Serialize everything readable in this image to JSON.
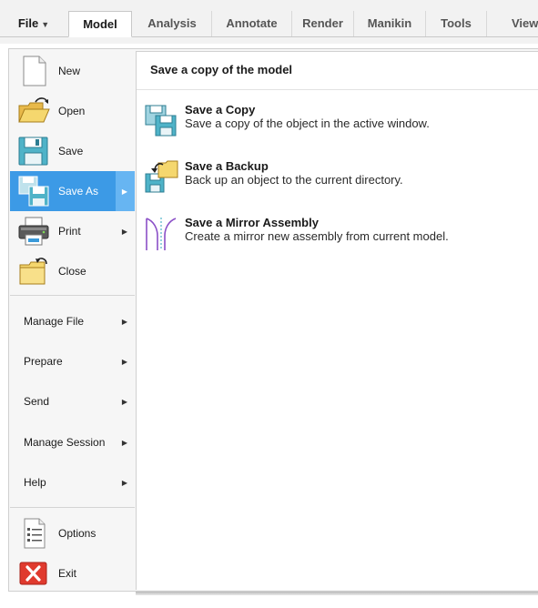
{
  "ribbon": {
    "file_tab": "File",
    "tabs": [
      "Model",
      "Analysis",
      "Annotate",
      "Render",
      "Manikin",
      "Tools",
      "View"
    ],
    "active_tab": "Model"
  },
  "file_menu": {
    "primary_items": [
      {
        "label": "New",
        "icon": "new-document-icon"
      },
      {
        "label": "Open",
        "icon": "open-folder-icon"
      },
      {
        "label": "Save",
        "icon": "save-icon"
      },
      {
        "label": "Save As",
        "icon": "save-as-icon",
        "selected": true,
        "has_submenu": true
      },
      {
        "label": "Print",
        "icon": "printer-icon",
        "has_submenu": true
      },
      {
        "label": "Close",
        "icon": "close-folder-icon"
      }
    ],
    "text_items": [
      {
        "label": "Manage File",
        "has_submenu": true
      },
      {
        "label": "Prepare",
        "has_submenu": true
      },
      {
        "label": "Send",
        "has_submenu": true
      },
      {
        "label": "Manage Session",
        "has_submenu": true
      },
      {
        "label": "Help",
        "has_submenu": true
      }
    ],
    "bottom_items": [
      {
        "label": "Options",
        "icon": "options-list-icon"
      },
      {
        "label": "Exit",
        "icon": "exit-icon"
      }
    ]
  },
  "submenu": {
    "title": "Save a copy of the model",
    "options": [
      {
        "title": "Save a Copy",
        "description": "Save a copy of the object in the active window.",
        "icon": "save-copy-icon"
      },
      {
        "title": "Save a Backup",
        "description": "Back up an object to the current directory.",
        "icon": "save-backup-icon"
      },
      {
        "title": "Save a Mirror Assembly",
        "description": "Create a mirror new assembly from current model.",
        "icon": "mirror-assembly-icon"
      }
    ]
  },
  "colors": {
    "selected_bg": "#3c9ae6",
    "selected_arrow_bg": "#67b5f2",
    "folder_yellow": "#f5d76e",
    "save_teal": "#4fb3c8",
    "exit_red": "#e03a2e",
    "mirror_purple": "#8a4fc7"
  }
}
